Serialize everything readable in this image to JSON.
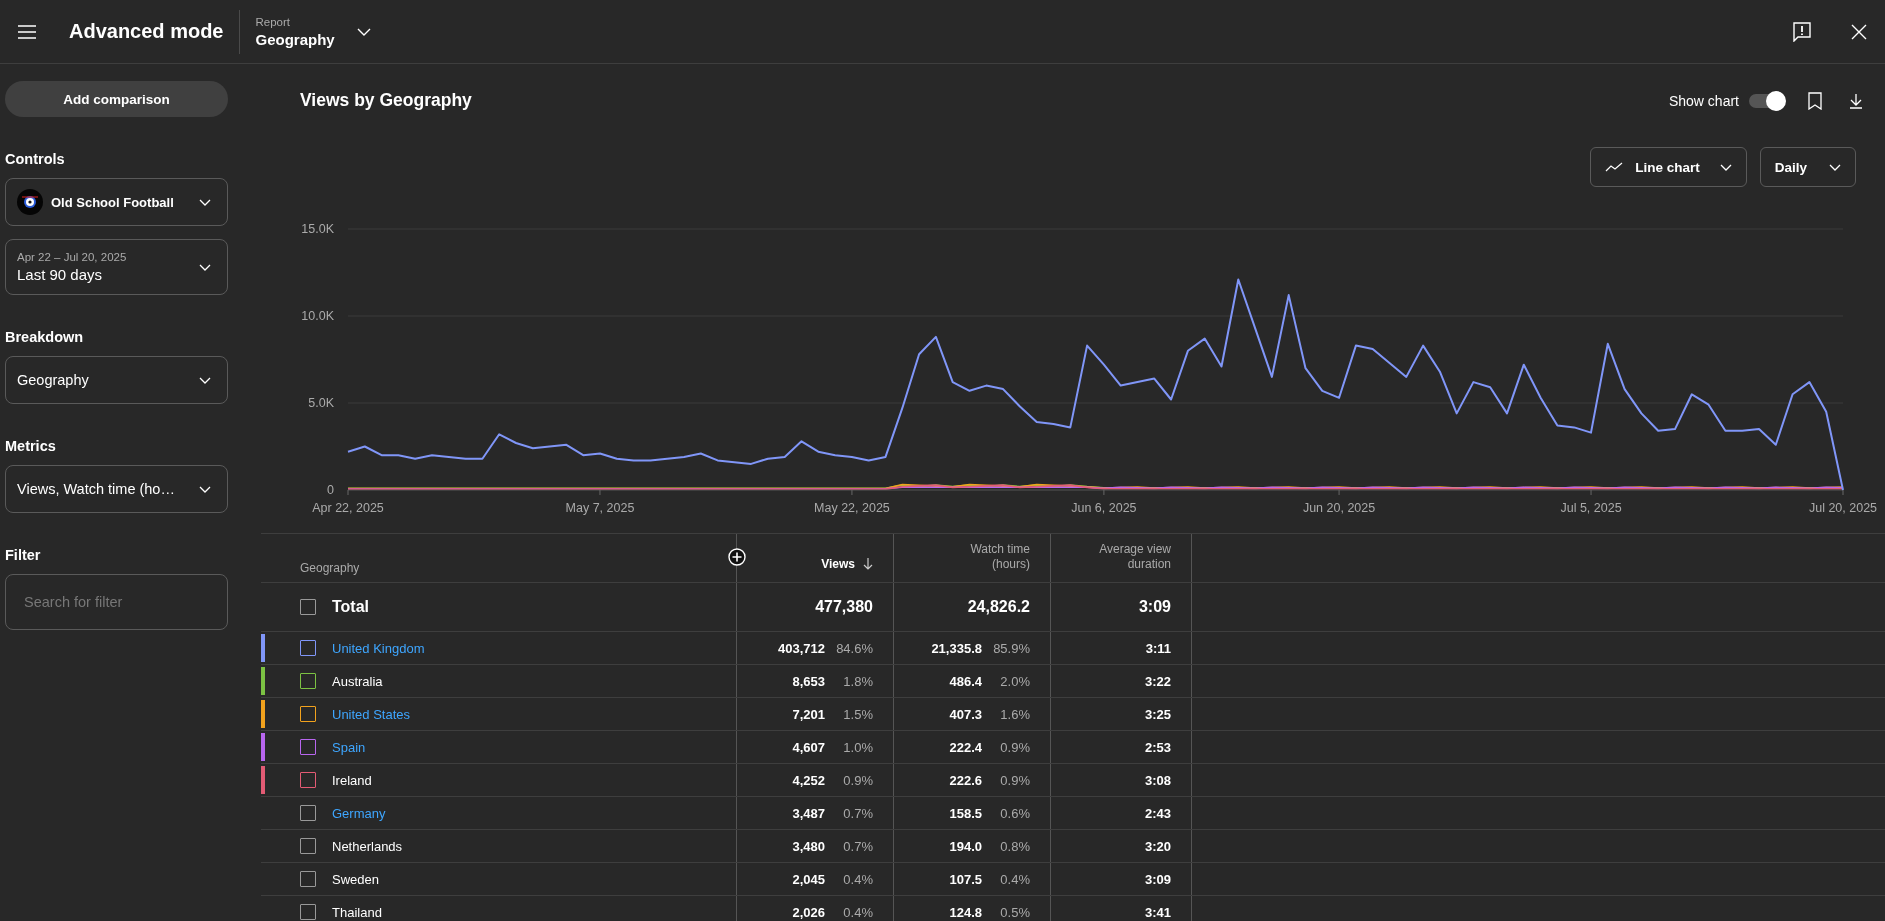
{
  "header": {
    "title": "Advanced mode",
    "report_label": "Report",
    "report_value": "Geography"
  },
  "sidebar": {
    "add_button": "Add comparison",
    "controls": {
      "heading": "Controls",
      "channel": "Old School Football",
      "date_caption": "Apr 22 – Jul 20, 2025",
      "date_value": "Last 90 days"
    },
    "breakdown": {
      "heading": "Breakdown",
      "value": "Geography"
    },
    "metrics": {
      "heading": "Metrics",
      "value": "Views, Watch time (ho…"
    },
    "filter": {
      "heading": "Filter",
      "placeholder": "Search for filter"
    }
  },
  "main": {
    "title": "Views by Geography",
    "show_chart": {
      "label": "Show chart",
      "on": true
    },
    "chart_type": "Line chart",
    "interval": "Daily",
    "chart_data": {
      "type": "line",
      "categories": [
        "Apr 22, 2025",
        null,
        null,
        null,
        null,
        null,
        null,
        null,
        null,
        null,
        null,
        null,
        null,
        null,
        null,
        "May 7, 2025",
        null,
        null,
        null,
        null,
        null,
        null,
        null,
        null,
        null,
        null,
        null,
        null,
        null,
        null,
        "May 22, 2025",
        null,
        null,
        null,
        null,
        null,
        null,
        null,
        null,
        null,
        null,
        null,
        null,
        null,
        null,
        "Jun 6, 2025",
        null,
        null,
        null,
        null,
        null,
        null,
        null,
        null,
        null,
        null,
        null,
        null,
        null,
        "Jun 20, 2025",
        null,
        null,
        null,
        null,
        null,
        null,
        null,
        null,
        null,
        null,
        null,
        null,
        null,
        null,
        "Jul 5, 2025",
        null,
        null,
        null,
        null,
        null,
        null,
        null,
        null,
        null,
        null,
        null,
        null,
        null,
        null,
        "Jul 20, 2025"
      ],
      "ylim": [
        0,
        15000
      ],
      "yticks": [
        {
          "value": 0,
          "label": "0"
        },
        {
          "value": 5000,
          "label": "5.0K"
        },
        {
          "value": 10000,
          "label": "10.0K"
        },
        {
          "value": 15000,
          "label": "15.0K"
        }
      ],
      "series": [
        {
          "color": "#8096f8",
          "values": [
            2200,
            2500,
            2000,
            2000,
            1800,
            2000,
            1900,
            1800,
            1800,
            3200,
            2700,
            2400,
            2500,
            2600,
            2000,
            2100,
            1800,
            1700,
            1700,
            1800,
            1900,
            2100,
            1700,
            1600,
            1500,
            1800,
            1900,
            2800,
            2200,
            2000,
            1900,
            1700,
            1900,
            4700,
            7800,
            8800,
            6200,
            5700,
            6000,
            5800,
            4800,
            3900,
            3800,
            3600,
            8300,
            7200,
            6000,
            6200,
            6400,
            5200,
            8000,
            8700,
            7100,
            12100,
            9300,
            6500,
            11200,
            7000,
            5700,
            5300,
            8300,
            8100,
            7300,
            6500,
            8300,
            6800,
            4400,
            6200,
            5900,
            4400,
            7200,
            5300,
            3700,
            3600,
            3300,
            8400,
            5800,
            4400,
            3400,
            3500,
            5500,
            4900,
            3400,
            3400,
            3500,
            2600,
            5500,
            6200,
            4500,
            0
          ]
        }
      ]
    }
  },
  "table": {
    "columns": [
      {
        "label": "Geography",
        "sorted": false
      },
      {
        "label": "Views",
        "sorted": true
      },
      {
        "label": "Watch time (hours)",
        "sorted": false
      },
      {
        "label": "Average view duration",
        "sorted": false
      }
    ],
    "total": {
      "name": "Total",
      "checked": false,
      "views": "477,380",
      "watch": "24,826.2",
      "avg": "3:09"
    },
    "rows": [
      {
        "name": "United Kingdom",
        "link": true,
        "selected": true,
        "color": "#8096f8",
        "views": "403,712",
        "views_pct": "84.6%",
        "watch": "21,335.8",
        "watch_pct": "85.9%",
        "avg": "3:11"
      },
      {
        "name": "Australia",
        "link": false,
        "selected": true,
        "color": "#7cc243",
        "views": "8,653",
        "views_pct": "1.8%",
        "watch": "486.4",
        "watch_pct": "2.0%",
        "avg": "3:22"
      },
      {
        "name": "United States",
        "link": true,
        "selected": true,
        "color": "#f2a21d",
        "views": "7,201",
        "views_pct": "1.5%",
        "watch": "407.3",
        "watch_pct": "1.6%",
        "avg": "3:25"
      },
      {
        "name": "Spain",
        "link": true,
        "selected": true,
        "color": "#b866ef",
        "views": "4,607",
        "views_pct": "1.0%",
        "watch": "222.4",
        "watch_pct": "0.9%",
        "avg": "2:53"
      },
      {
        "name": "Ireland",
        "link": false,
        "selected": true,
        "color": "#e35b74",
        "views": "4,252",
        "views_pct": "0.9%",
        "watch": "222.6",
        "watch_pct": "0.9%",
        "avg": "3:08"
      },
      {
        "name": "Germany",
        "link": true,
        "selected": false,
        "views": "3,487",
        "views_pct": "0.7%",
        "watch": "158.5",
        "watch_pct": "0.6%",
        "avg": "2:43"
      },
      {
        "name": "Netherlands",
        "link": false,
        "selected": false,
        "views": "3,480",
        "views_pct": "0.7%",
        "watch": "194.0",
        "watch_pct": "0.8%",
        "avg": "3:20"
      },
      {
        "name": "Sweden",
        "link": false,
        "selected": false,
        "views": "2,045",
        "views_pct": "0.4%",
        "watch": "107.5",
        "watch_pct": "0.4%",
        "avg": "3:09"
      },
      {
        "name": "Thailand",
        "link": false,
        "selected": false,
        "views": "2,026",
        "views_pct": "0.4%",
        "watch": "124.8",
        "watch_pct": "0.5%",
        "avg": "3:41"
      }
    ]
  }
}
